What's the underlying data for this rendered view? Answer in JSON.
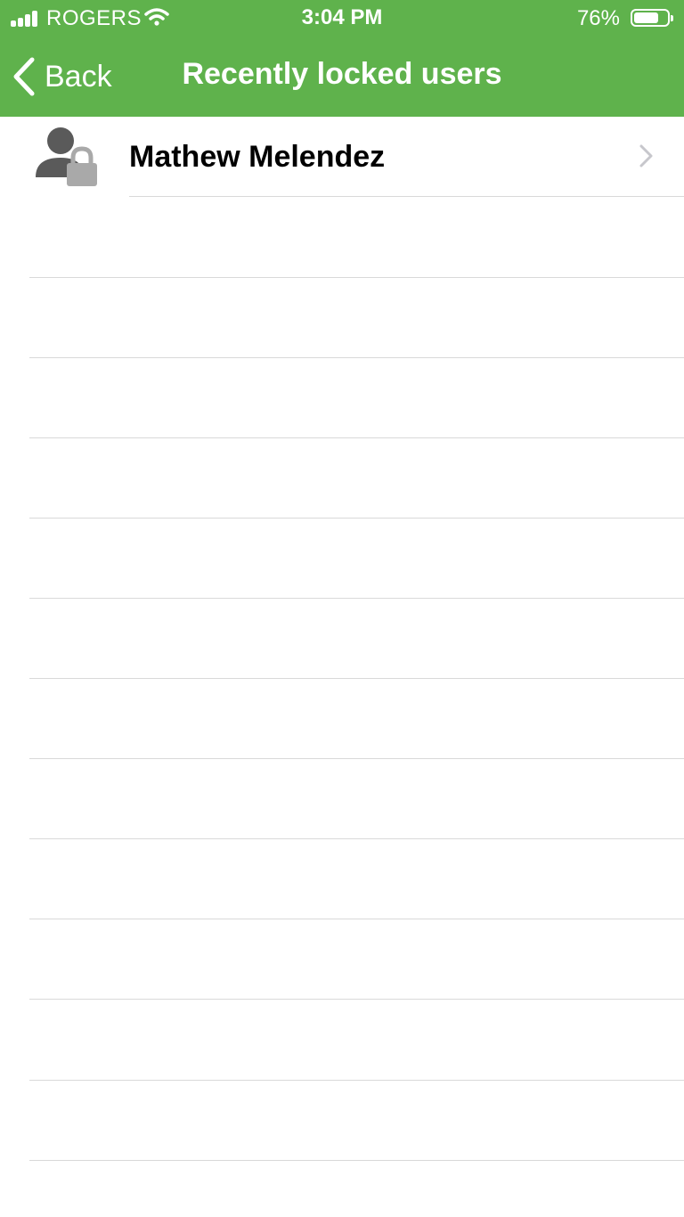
{
  "status_bar": {
    "carrier": "ROGERS",
    "time": "3:04 PM",
    "battery_percent": "76%",
    "battery_level": 0.76,
    "icons": [
      "signal-icon",
      "wifi-icon",
      "battery-icon"
    ]
  },
  "nav": {
    "back_label": "Back",
    "title": "Recently locked users"
  },
  "locked_users": [
    {
      "name": "Mathew Melendez",
      "icon": "locked-user-icon"
    }
  ],
  "colors": {
    "header": "#5fb24c",
    "header_text": "#ffffff",
    "separator": "#d9d9d9",
    "chevron": "#c7c7cc",
    "avatar_person": "#5a5a5a",
    "avatar_lock": "#a9a9a9"
  }
}
